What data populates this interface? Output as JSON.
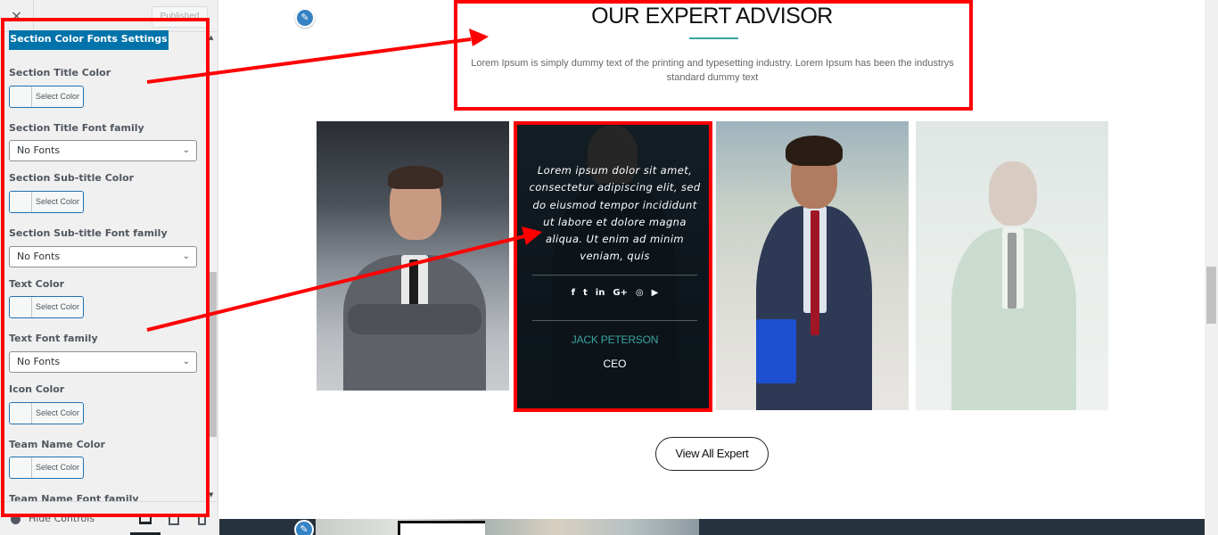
{
  "customizer": {
    "close_icon": "×",
    "publish_label": "Published",
    "section_button": "Section Color Fonts Settings",
    "controls": [
      {
        "label": "Section Title Color",
        "type": "color",
        "button": "Select Color"
      },
      {
        "label": "Section Title Font family",
        "type": "select",
        "value": "No Fonts"
      },
      {
        "label": "Section Sub-title Color",
        "type": "color",
        "button": "Select Color"
      },
      {
        "label": "Section Sub-title Font family",
        "type": "select",
        "value": "No Fonts"
      },
      {
        "label": "Text Color",
        "type": "color",
        "button": "Select Color"
      },
      {
        "label": "Text Font family",
        "type": "select",
        "value": "No Fonts"
      },
      {
        "label": "Icon Color",
        "type": "color",
        "button": "Select Color"
      },
      {
        "label": "Team Name Color",
        "type": "color",
        "button": "Select Color"
      },
      {
        "label": "Team Name Font family",
        "type": "select",
        "value": ""
      }
    ],
    "footer": {
      "hide_controls": "Hide Controls",
      "devices": [
        "desktop",
        "tablet",
        "mobile"
      ],
      "active_device": "desktop"
    }
  },
  "preview": {
    "edit_icon": "✎",
    "section_title": "OUR EXPERT ADVISOR",
    "section_subtitle": "Lorem Ipsum is simply dummy text of the printing and typesetting industry. Lorem Ipsum has been the industrys standard dummy text",
    "team": [
      {
        "photo": "young-man-grey-suit-arms-crossed"
      },
      {
        "photo": "bearded-man-dark-suit",
        "hovered": true,
        "description": "Lorem ipsum dolor sit amet, consectetur adipiscing elit, sed do eiusmod tempor incididunt ut labore et dolore magna aliqua. Ut enim ad minim veniam, quis",
        "social": [
          "f",
          "t",
          "in",
          "G+",
          "◎",
          "▶"
        ],
        "social_icons": [
          "facebook-icon",
          "twitter-icon",
          "linkedin-icon",
          "google-plus-icon",
          "instagram-icon",
          "youtube-icon"
        ],
        "name": "JACK PETERSON",
        "role": "CEO"
      },
      {
        "photo": "curly-hair-man-red-tie-blue-folder"
      },
      {
        "photo": "bearded-man-light-suit-faded"
      }
    ],
    "view_all_button": "View All Expert"
  },
  "colors": {
    "accent": "#3aa59f",
    "wp_blue": "#0073aa",
    "annotation_red": "#ff0000"
  }
}
